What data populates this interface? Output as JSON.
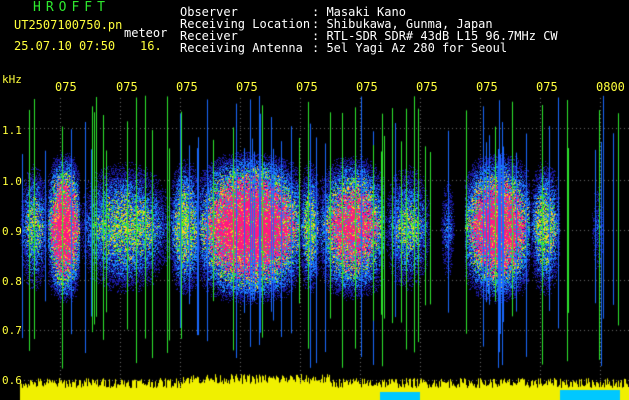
{
  "header": {
    "title": "HROFFT",
    "filename": "UT2507100750.pn",
    "label": "meteor",
    "datetime": "25.07.10 07:50",
    "number": "16."
  },
  "meta": [
    {
      "label": "Observer",
      "value": ": Masaki Kano"
    },
    {
      "label": "Receiving Location",
      "value": ": Shibukawa, Gunma, Japan"
    },
    {
      "label": "Receiver",
      "value": ": RTL-SDR SDR# 43dB L15 96.7MHz CW"
    },
    {
      "label": "Receiving Antenna",
      "value": ": 5el Yagi Az 280 for Seoul"
    }
  ],
  "axis": {
    "unit": "kHz",
    "y_ticks": [
      "1.1",
      "1.0",
      "0.9",
      "0.8",
      "0.7",
      "0.6"
    ],
    "x_ticks": [
      "075",
      "075",
      "075",
      "075",
      "075",
      "075",
      "075",
      "075",
      "075",
      "0800"
    ]
  },
  "colors": {
    "background": "#000000",
    "text_yellow": "#ffff3c",
    "title_green": "#2ee82e",
    "signal_hot": "#ff1a80",
    "signal_mid": "#1a8cff",
    "signal_low": "#1a1aa0",
    "bars": "#f0f000"
  }
}
